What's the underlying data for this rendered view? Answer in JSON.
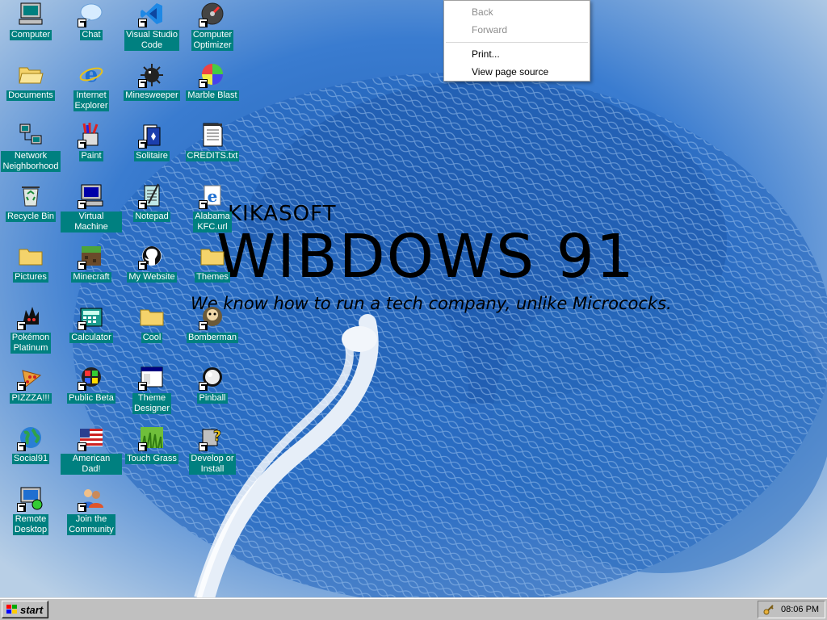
{
  "desktop": {
    "icons": [
      {
        "label": "Computer",
        "icon": "computer-icon",
        "shortcut": false
      },
      {
        "label": "Chat",
        "icon": "chat-icon",
        "shortcut": true
      },
      {
        "label": "Visual Studio\nCode",
        "icon": "vscode-icon",
        "shortcut": true
      },
      {
        "label": "Computer\nOptimizer",
        "icon": "optimizer-icon",
        "shortcut": true
      },
      {
        "label": "Documents",
        "icon": "folder-open-icon",
        "shortcut": false
      },
      {
        "label": "Internet\nExplorer",
        "icon": "internet-explorer-icon",
        "shortcut": false
      },
      {
        "label": "Minesweeper",
        "icon": "minesweeper-icon",
        "shortcut": true
      },
      {
        "label": "Marble Blast",
        "icon": "marble-icon",
        "shortcut": true
      },
      {
        "label": "Network\nNeighborhood",
        "icon": "network-icon",
        "shortcut": false
      },
      {
        "label": "Paint",
        "icon": "paint-icon",
        "shortcut": true
      },
      {
        "label": "Solitaire",
        "icon": "solitaire-icon",
        "shortcut": true
      },
      {
        "label": "CREDITS.txt",
        "icon": "text-file-icon",
        "shortcut": false
      },
      {
        "label": "Recycle Bin",
        "icon": "recycle-bin-icon",
        "shortcut": false
      },
      {
        "label": "Virtual Machine",
        "icon": "virtual-machine-icon",
        "shortcut": true
      },
      {
        "label": "Notepad",
        "icon": "notepad-icon",
        "shortcut": true
      },
      {
        "label": "Alabama\nKFC.url",
        "icon": "internet-shortcut-icon",
        "shortcut": true
      },
      {
        "label": "Pictures",
        "icon": "folder-icon",
        "shortcut": false
      },
      {
        "label": "Minecraft",
        "icon": "minecraft-icon",
        "shortcut": true
      },
      {
        "label": "My Website",
        "icon": "github-icon",
        "shortcut": true
      },
      {
        "label": "Themes",
        "icon": "folder-icon",
        "shortcut": false
      },
      {
        "label": "Pokémon\nPlatinum",
        "icon": "pokemon-icon",
        "shortcut": true
      },
      {
        "label": "Calculator",
        "icon": "calculator-icon",
        "shortcut": true
      },
      {
        "label": "Cool",
        "icon": "folder-icon",
        "shortcut": false
      },
      {
        "label": "Bomberman",
        "icon": "bomberman-icon",
        "shortcut": true
      },
      {
        "label": "PIZZZA!!!",
        "icon": "pizza-icon",
        "shortcut": true
      },
      {
        "label": "Public Beta",
        "icon": "windows-flag-icon",
        "shortcut": true
      },
      {
        "label": "Theme\nDesigner",
        "icon": "window-icon",
        "shortcut": true
      },
      {
        "label": "Pinball",
        "icon": "pinball-icon",
        "shortcut": true
      },
      {
        "label": "Social91",
        "icon": "globe-icon",
        "shortcut": true
      },
      {
        "label": "American Dad!",
        "icon": "american-flag-icon",
        "shortcut": true
      },
      {
        "label": "Touch Grass",
        "icon": "grass-icon",
        "shortcut": true
      },
      {
        "label": "Develop or\nInstall",
        "icon": "help-icon",
        "shortcut": true
      },
      {
        "label": "Remote\nDesktop",
        "icon": "remote-desktop-icon",
        "shortcut": true
      },
      {
        "label": "Join the\nCommunity",
        "icon": "community-icon",
        "shortcut": true
      }
    ]
  },
  "wallpaper": {
    "brand_small": "KIKASOFT",
    "brand_big": "WIBDOWS 91",
    "tagline": "We know how to run a tech company, unlike Micrococks."
  },
  "context_menu": {
    "back": "Back",
    "forward": "Forward",
    "print": "Print...",
    "view_source": "View page source"
  },
  "taskbar": {
    "start_label": "start",
    "clock": "08:06 PM"
  },
  "colors": {
    "desktop_label_bg": "#008080",
    "taskbar": "#c0c0c0",
    "wallpaper_blue": "#2f72c6"
  }
}
